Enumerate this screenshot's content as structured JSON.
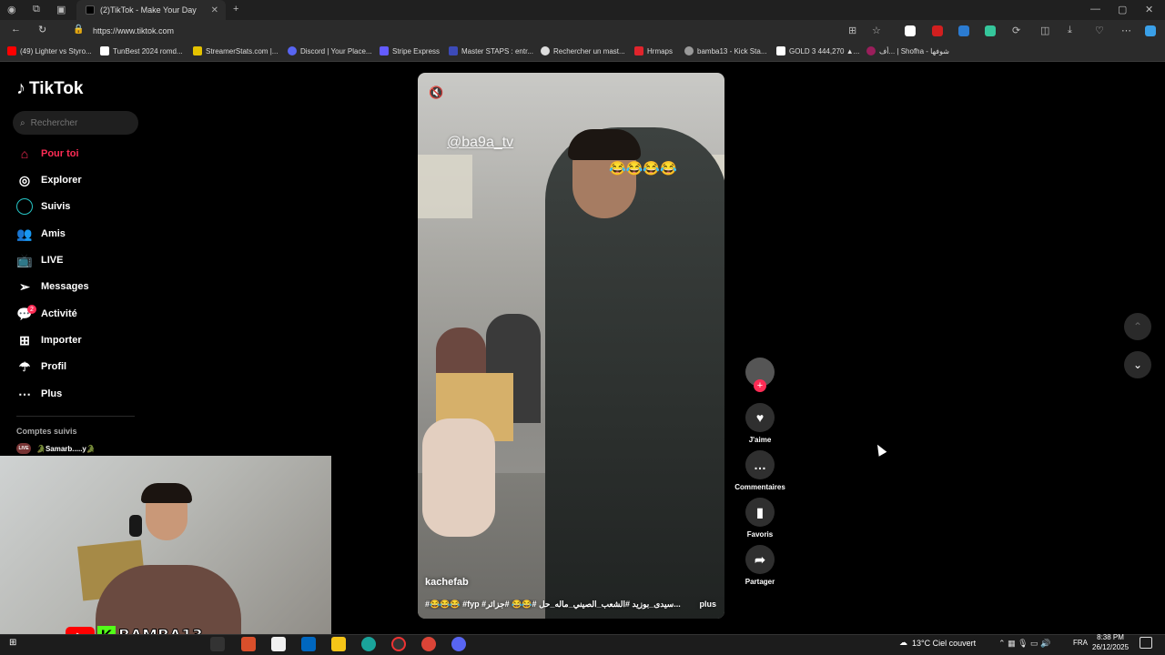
{
  "browser": {
    "tab_title": "(2)TikTok - Make Your Day",
    "url": "https://www.tiktok.com",
    "bookmarks": [
      "(49) Lighter vs Styro...",
      "TunBest 2024 romd...",
      "StreamerStats.com |...",
      "Discord | Your Place...",
      "Stripe Express",
      "Master STAPS : entr...",
      "Rechercher un mast...",
      "Hrmaps",
      "bamba13 - Kick Sta...",
      "GOLD 3 444,270 ▲...",
      "أف... | Shofha - شوفها"
    ]
  },
  "sidebar": {
    "logo": "TikTok",
    "search_placeholder": "Rechercher",
    "nav": [
      "Pour toi",
      "Explorer",
      "Suivis",
      "Amis",
      "LIVE",
      "Messages",
      "Activité",
      "Importer",
      "Profil",
      "Plus"
    ],
    "activity_badge": "2",
    "following_title": "Comptes suivis",
    "following_live_tag": "LIVE",
    "following_account": "🐊Samarb.....y🐊"
  },
  "stream": {
    "youtube_label": "▶",
    "kick_label": "K",
    "name": "BAMBA13"
  },
  "video": {
    "watermark": "@ba9a_tv",
    "emojis": "😂😂😂😂",
    "author": "kachefab",
    "caption": "#😂😂😂 #fyp #سيدى_بوزيد #الشعب_الصيني_ماله_حل #😂😂 #جزائر...",
    "more": "plus",
    "mute_icon": "🔇"
  },
  "actions": {
    "follow_plus": "+",
    "like": "J'aime",
    "comment": "Commentaires",
    "favorite": "Favoris",
    "share": "Partager"
  },
  "taskbar": {
    "weather": "13°C  Ciel couvert",
    "lang": "FRA",
    "time": "8:38 PM",
    "date": "26/12/2025"
  }
}
